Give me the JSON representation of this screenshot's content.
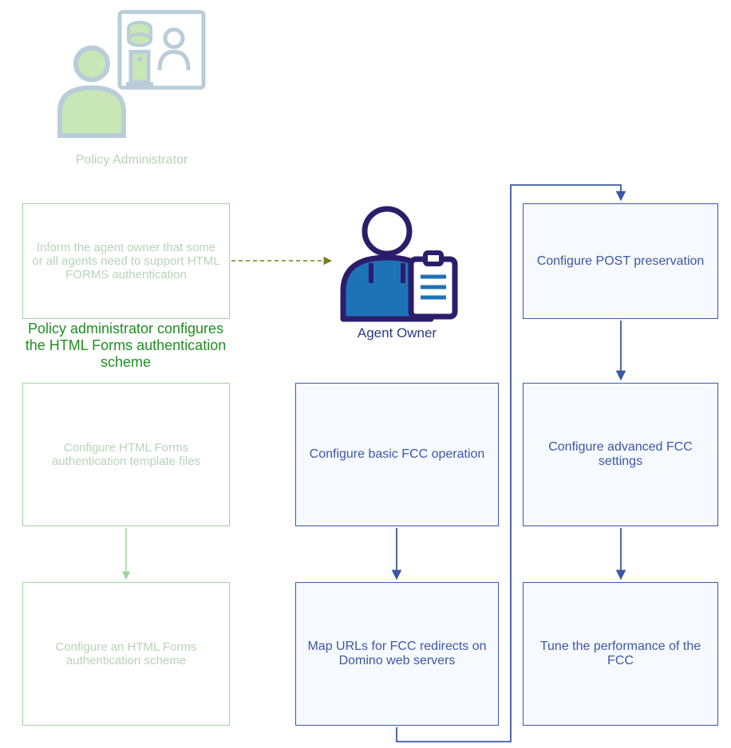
{
  "chart_data": {
    "type": "flowchart",
    "actors": [
      {
        "id": "policy_admin",
        "label": "Policy Administrator",
        "state": "faded"
      },
      {
        "id": "agent_owner",
        "label": "Agent Owner",
        "state": "active"
      }
    ],
    "section_title": "Policy administrator configures the HTML Forms authentication scheme",
    "nodes": [
      {
        "id": "pa1",
        "text": "Inform the agent owner that some or all agents need to support HTML FORMS authentication",
        "group": "policy_admin",
        "state": "faded"
      },
      {
        "id": "pa2",
        "text": "Configure HTML Forms authentication template files",
        "group": "policy_admin",
        "state": "faded"
      },
      {
        "id": "pa3",
        "text": "Configure an HTML Forms authentication scheme",
        "group": "policy_admin",
        "state": "faded"
      },
      {
        "id": "ao1",
        "text": "Configure basic FCC operation",
        "group": "agent_owner",
        "state": "active"
      },
      {
        "id": "ao2",
        "text": "Map URLs for FCC redirects on Domino web servers",
        "group": "agent_owner",
        "state": "active"
      },
      {
        "id": "ao3",
        "text": "Configure POST preservation",
        "group": "agent_owner",
        "state": "active"
      },
      {
        "id": "ao4",
        "text": "Configure advanced FCC settings",
        "group": "agent_owner",
        "state": "active"
      },
      {
        "id": "ao5",
        "text": "Tune the performance of the FCC",
        "group": "agent_owner",
        "state": "active"
      }
    ],
    "edges": [
      {
        "from": "pa1",
        "to": "agent_owner",
        "style": "dashed",
        "color": "olive"
      },
      {
        "from": "pa1",
        "to": "pa2",
        "style": "solid",
        "color": "faded-green",
        "via_title": true
      },
      {
        "from": "pa2",
        "to": "pa3",
        "style": "solid",
        "color": "faded-green"
      },
      {
        "from": "agent_owner",
        "to": "ao1",
        "style": "implicit"
      },
      {
        "from": "ao1",
        "to": "ao2",
        "style": "solid",
        "color": "blue"
      },
      {
        "from": "ao2",
        "to": "ao3",
        "style": "solid",
        "color": "blue",
        "route": "elbow"
      },
      {
        "from": "ao3",
        "to": "ao4",
        "style": "solid",
        "color": "blue"
      },
      {
        "from": "ao4",
        "to": "ao5",
        "style": "solid",
        "color": "blue"
      }
    ]
  },
  "labels": {
    "policy_admin": "Policy Administrator",
    "agent_owner": "Agent Owner",
    "section_title": "Policy administrator configures the HTML Forms authentication scheme"
  },
  "boxes": {
    "pa1": "Inform the agent owner that some or all agents need to support HTML FORMS authentication",
    "pa2": "Configure HTML Forms authentication template files",
    "pa3": "Configure an HTML Forms authentication scheme",
    "ao1": "Configure basic FCC operation",
    "ao2": "Map URLs for FCC redirects on Domino web servers",
    "ao3": "Configure POST preservation",
    "ao4": "Configure advanced FCC settings",
    "ao5": "Tune the performance of the FCC"
  }
}
